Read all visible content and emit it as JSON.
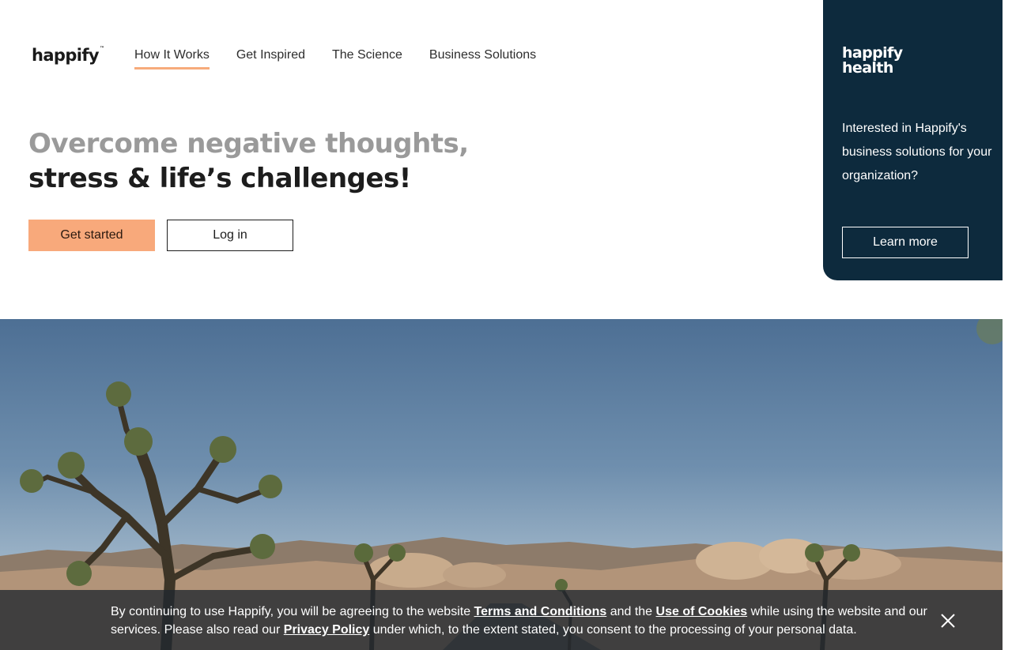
{
  "header": {
    "logo_text": "happify",
    "nav": [
      {
        "label": "How It Works",
        "active": true
      },
      {
        "label": "Get Inspired",
        "active": false
      },
      {
        "label": "The Science",
        "active": false
      },
      {
        "label": "Business Solutions",
        "active": false
      }
    ]
  },
  "hero": {
    "title_line1": "Overcome negative thoughts,",
    "title_line2": "stress & life’s challenges!",
    "primary_button": "Get started",
    "secondary_button": "Log in"
  },
  "business_panel": {
    "logo_line1": "happify",
    "logo_line2": "health",
    "text": "Interested in Happify's business solutions for your organization?",
    "button": "Learn more",
    "background_color": "#0d2a3d"
  },
  "cookie_banner": {
    "text_1": "By continuing to use Happify, you will be agreeing to the website ",
    "link_terms": "Terms and Conditions",
    "text_2": " and the ",
    "link_cookies": "Use of Cookies",
    "text_3": " while using the website and our services. Please also read our ",
    "link_privacy": "Privacy Policy",
    "text_4": " under which, to the extent stated, you consent to the processing of your personal data.",
    "close_icon": "close-icon"
  },
  "colors": {
    "accent": "#f8a97b",
    "nav_underline": "#f7ab7b"
  }
}
